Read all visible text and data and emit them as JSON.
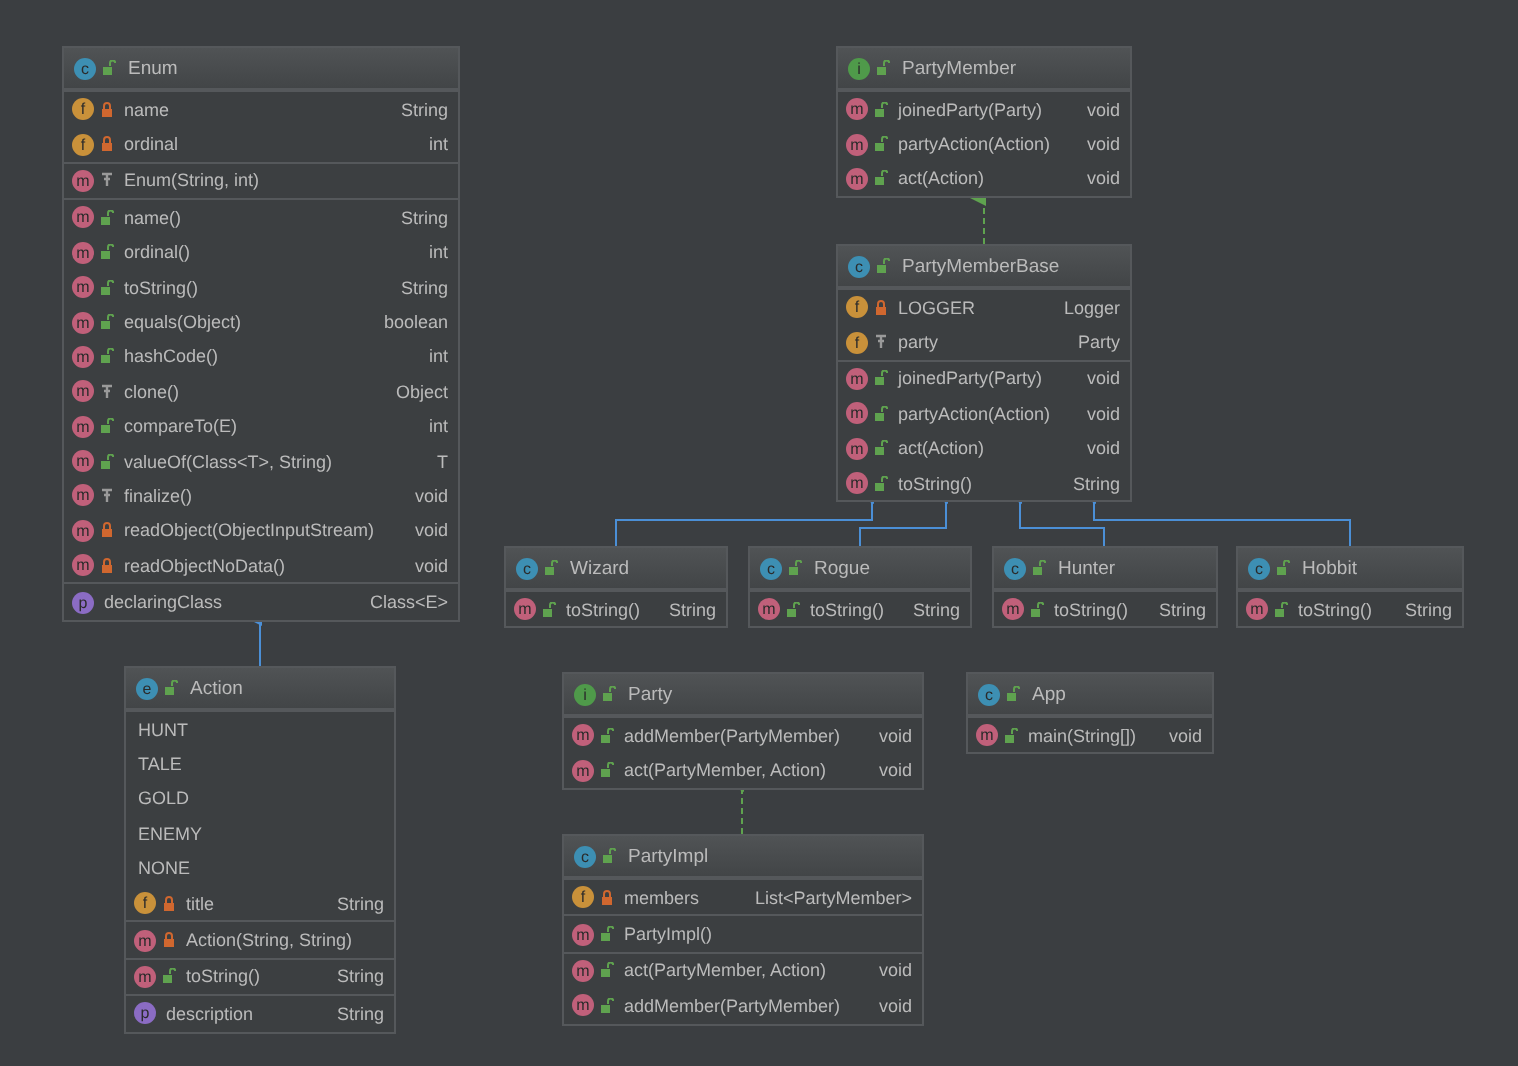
{
  "nodes": [
    {
      "kind": "class",
      "badge": "c",
      "access": {
        "kind": "public"
      },
      "title": "Enum",
      "sections": [
        [
          {
            "kind": "field",
            "badge": "f",
            "access": {
              "kind": "private"
            },
            "name": "name",
            "type": "String"
          },
          {
            "kind": "field",
            "badge": "f",
            "access": {
              "kind": "private"
            },
            "name": "ordinal",
            "type": "int"
          }
        ],
        [
          {
            "kind": "method",
            "badge": "m",
            "access": {
              "kind": "protected"
            },
            "name": "Enum(String, int)"
          }
        ],
        [
          {
            "kind": "method",
            "badge": "m",
            "access": {
              "kind": "public"
            },
            "name": "name()",
            "type": "String"
          },
          {
            "kind": "method",
            "badge": "m",
            "access": {
              "kind": "public"
            },
            "name": "ordinal()",
            "type": "int"
          },
          {
            "kind": "method",
            "badge": "m",
            "access": {
              "kind": "public"
            },
            "name": "toString()",
            "type": "String"
          },
          {
            "kind": "method",
            "badge": "m",
            "access": {
              "kind": "public"
            },
            "name": "equals(Object)",
            "type": "boolean"
          },
          {
            "kind": "method",
            "badge": "m",
            "access": {
              "kind": "public"
            },
            "name": "hashCode()",
            "type": "int"
          },
          {
            "kind": "method",
            "badge": "m",
            "access": {
              "kind": "protected"
            },
            "name": "clone()",
            "type": "Object"
          },
          {
            "kind": "method",
            "badge": "m",
            "access": {
              "kind": "public"
            },
            "name": "compareTo(E)",
            "type": "int"
          },
          {
            "kind": "method",
            "badge": "m",
            "access": {
              "kind": "public"
            },
            "name": "valueOf(Class<T>, String)",
            "type": "T"
          },
          {
            "kind": "method",
            "badge": "m",
            "access": {
              "kind": "protected"
            },
            "name": "finalize()",
            "type": "void"
          },
          {
            "kind": "method",
            "badge": "m",
            "access": {
              "kind": "private"
            },
            "name": "readObject(ObjectInputStream)",
            "type": "void"
          },
          {
            "kind": "method",
            "badge": "m",
            "access": {
              "kind": "private"
            },
            "name": "readObjectNoData()",
            "type": "void"
          }
        ],
        [
          {
            "kind": "property",
            "badge": "p",
            "name": "declaringClass",
            "type": "Class<E>"
          }
        ]
      ]
    },
    {
      "kind": "enum",
      "badge": "e",
      "access": {
        "kind": "public"
      },
      "title": "Action",
      "sections": [
        [
          {
            "kind": "constant",
            "name": "HUNT"
          },
          {
            "kind": "constant",
            "name": "TALE"
          },
          {
            "kind": "constant",
            "name": "GOLD"
          },
          {
            "kind": "constant",
            "name": "ENEMY"
          },
          {
            "kind": "constant",
            "name": "NONE"
          },
          {
            "kind": "field",
            "badge": "f",
            "access": {
              "kind": "private"
            },
            "name": "title",
            "type": "String"
          }
        ],
        [
          {
            "kind": "method",
            "badge": "m",
            "access": {
              "kind": "private"
            },
            "name": "Action(String, String)"
          }
        ],
        [
          {
            "kind": "method",
            "badge": "m",
            "access": {
              "kind": "public"
            },
            "name": "toString()",
            "type": "String"
          }
        ],
        [
          {
            "kind": "property",
            "badge": "p",
            "name": "description",
            "type": "String"
          }
        ]
      ]
    },
    {
      "kind": "interface",
      "badge": "i",
      "access": {
        "kind": "public"
      },
      "title": "PartyMember",
      "sections": [
        [
          {
            "kind": "method",
            "badge": "m",
            "access": {
              "kind": "public"
            },
            "name": "joinedParty(Party)",
            "type": "void"
          },
          {
            "kind": "method",
            "badge": "m",
            "access": {
              "kind": "public"
            },
            "name": "partyAction(Action)",
            "type": "void"
          },
          {
            "kind": "method",
            "badge": "m",
            "access": {
              "kind": "public"
            },
            "name": "act(Action)",
            "type": "void"
          }
        ]
      ]
    },
    {
      "kind": "class",
      "badge": "c",
      "access": {
        "kind": "public"
      },
      "title": "PartyMemberBase",
      "sections": [
        [
          {
            "kind": "field",
            "badge": "f",
            "access": {
              "kind": "private"
            },
            "name": "LOGGER",
            "type": "Logger"
          },
          {
            "kind": "field",
            "badge": "f",
            "access": {
              "kind": "protected"
            },
            "name": "party",
            "type": "Party"
          }
        ],
        [
          {
            "kind": "method",
            "badge": "m",
            "access": {
              "kind": "public"
            },
            "name": "joinedParty(Party)",
            "type": "void"
          },
          {
            "kind": "method",
            "badge": "m",
            "access": {
              "kind": "public"
            },
            "name": "partyAction(Action)",
            "type": "void"
          },
          {
            "kind": "method",
            "badge": "m",
            "access": {
              "kind": "public"
            },
            "name": "act(Action)",
            "type": "void"
          },
          {
            "kind": "method",
            "badge": "m",
            "access": {
              "kind": "public"
            },
            "name": "toString()",
            "type": "String"
          }
        ]
      ]
    },
    {
      "kind": "class",
      "badge": "c",
      "access": {
        "kind": "public"
      },
      "title": "Wizard",
      "sections": [
        [
          {
            "kind": "method",
            "badge": "m",
            "access": {
              "kind": "public"
            },
            "name": "toString()",
            "type": "String"
          }
        ]
      ]
    },
    {
      "kind": "class",
      "badge": "c",
      "access": {
        "kind": "public"
      },
      "title": "Rogue",
      "sections": [
        [
          {
            "kind": "method",
            "badge": "m",
            "access": {
              "kind": "public"
            },
            "name": "toString()",
            "type": "String"
          }
        ]
      ]
    },
    {
      "kind": "class",
      "badge": "c",
      "access": {
        "kind": "public"
      },
      "title": "Hunter",
      "sections": [
        [
          {
            "kind": "method",
            "badge": "m",
            "access": {
              "kind": "public"
            },
            "name": "toString()",
            "type": "String"
          }
        ]
      ]
    },
    {
      "kind": "class",
      "badge": "c",
      "access": {
        "kind": "public"
      },
      "title": "Hobbit",
      "sections": [
        [
          {
            "kind": "method",
            "badge": "m",
            "access": {
              "kind": "public"
            },
            "name": "toString()",
            "type": "String"
          }
        ]
      ]
    },
    {
      "kind": "interface",
      "badge": "i",
      "access": {
        "kind": "public"
      },
      "title": "Party",
      "sections": [
        [
          {
            "kind": "method",
            "badge": "m",
            "access": {
              "kind": "public"
            },
            "name": "addMember(PartyMember)",
            "type": "void"
          },
          {
            "kind": "method",
            "badge": "m",
            "access": {
              "kind": "public"
            },
            "name": "act(PartyMember, Action)",
            "type": "void"
          }
        ]
      ]
    },
    {
      "kind": "class",
      "badge": "c",
      "access": {
        "kind": "public"
      },
      "title": "PartyImpl",
      "sections": [
        [
          {
            "kind": "field",
            "badge": "f",
            "access": {
              "kind": "private"
            },
            "name": "members",
            "type": "List<PartyMember>"
          }
        ],
        [
          {
            "kind": "method",
            "badge": "m",
            "access": {
              "kind": "public"
            },
            "name": "PartyImpl()"
          }
        ],
        [
          {
            "kind": "method",
            "badge": "m",
            "access": {
              "kind": "public"
            },
            "name": "act(PartyMember, Action)",
            "type": "void"
          },
          {
            "kind": "method",
            "badge": "m",
            "access": {
              "kind": "public"
            },
            "name": "addMember(PartyMember)",
            "type": "void"
          }
        ]
      ]
    },
    {
      "kind": "class",
      "badge": "c",
      "access": {
        "kind": "public"
      },
      "title": "App",
      "sections": [
        [
          {
            "kind": "method",
            "badge": "m",
            "access": {
              "kind": "public"
            },
            "name": "main(String[])",
            "type": "void"
          }
        ]
      ]
    }
  ]
}
